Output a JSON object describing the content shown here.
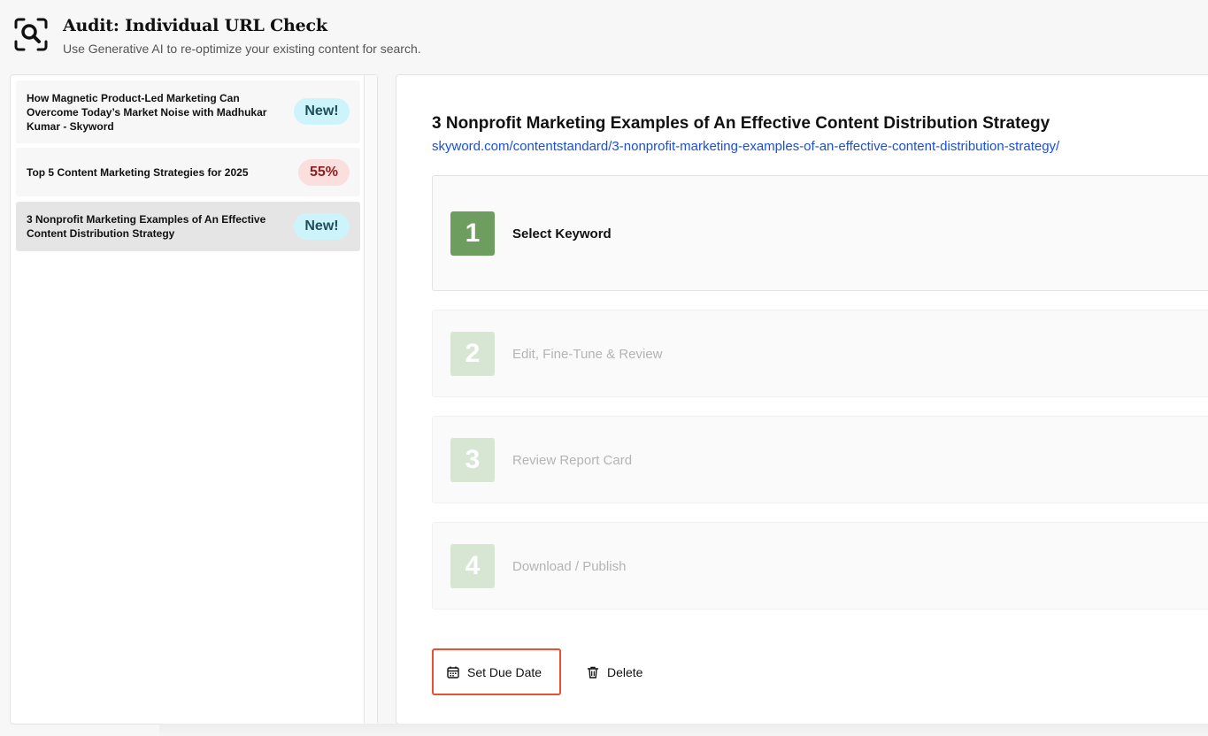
{
  "header": {
    "title": "Audit: Individual URL Check",
    "subtitle": "Use Generative AI to re-optimize your existing content for search."
  },
  "sidebar": {
    "items": [
      {
        "title": "How Magnetic Product-Led Marketing Can Overcome Today’s Market Noise with Madhukar Kumar - Skyword",
        "badge": "New!"
      },
      {
        "title": "Top 5 Content Marketing Strategies for 2025",
        "badge": "55%"
      },
      {
        "title": "3 Nonprofit Marketing Examples of An Effective Content Distribution Strategy",
        "badge": "New!"
      }
    ]
  },
  "main": {
    "title": "3 Nonprofit Marketing Examples of An Effective Content Distribution Strategy",
    "url": "skyword.com/contentstandard/3-nonprofit-marketing-examples-of-an-effective-content-distribution-strategy/",
    "steps": [
      {
        "num": "1",
        "label": "Select Keyword"
      },
      {
        "num": "2",
        "label": "Edit, Fine-Tune & Review"
      },
      {
        "num": "3",
        "label": "Review Report Card"
      },
      {
        "num": "4",
        "label": "Download / Publish"
      }
    ],
    "actions": {
      "due_date_label": "Set Due Date",
      "delete_label": "Delete"
    }
  },
  "colors": {
    "accent_green": "#6d9e5f",
    "inactive_green": "#d7e6d2",
    "link_blue": "#1a4fd6",
    "due_date_border": "#e8502f",
    "badge_new_bg": "#cdf4fa",
    "badge_pct_bg": "#fbdede"
  }
}
